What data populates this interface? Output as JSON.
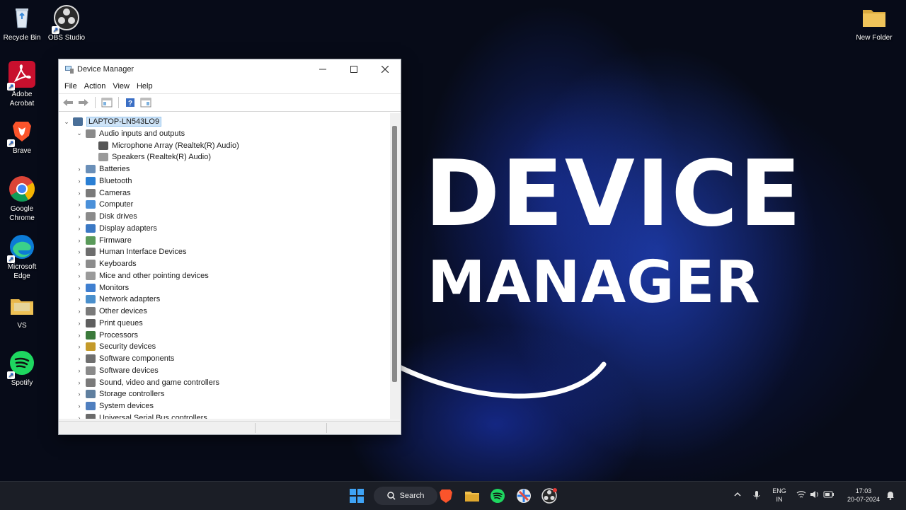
{
  "desktop": {
    "icons_left": [
      {
        "label": "Recycle Bin",
        "icon": "recycle-bin-icon"
      },
      {
        "label": "OBS Studio",
        "icon": "obs-icon"
      },
      {
        "label": "Adobe Acrobat",
        "icon": "acrobat-icon"
      },
      {
        "label": "Brave",
        "icon": "brave-icon"
      },
      {
        "label": "Google Chrome",
        "icon": "chrome-icon"
      },
      {
        "label": "Microsoft Edge",
        "icon": "edge-icon"
      },
      {
        "label": "VS",
        "icon": "folder-icon"
      },
      {
        "label": "Spotify",
        "icon": "spotify-icon"
      }
    ],
    "icon_right": {
      "label": "New Folder",
      "icon": "folder-icon"
    }
  },
  "window": {
    "title": "Device Manager",
    "menu": [
      "File",
      "Action",
      "View",
      "Help"
    ],
    "tree": {
      "root": "LAPTOP-LN543LO9",
      "expanded_category": "Audio inputs and outputs",
      "expanded_children": [
        "Microphone Array (Realtek(R) Audio)",
        "Speakers (Realtek(R) Audio)"
      ],
      "categories": [
        "Batteries",
        "Bluetooth",
        "Cameras",
        "Computer",
        "Disk drives",
        "Display adapters",
        "Firmware",
        "Human Interface Devices",
        "Keyboards",
        "Mice and other pointing devices",
        "Monitors",
        "Network adapters",
        "Other devices",
        "Print queues",
        "Processors",
        "Security devices",
        "Software components",
        "Software devices",
        "Sound, video and game controllers",
        "Storage controllers",
        "System devices",
        "Universal Serial Bus controllers"
      ]
    }
  },
  "headline": {
    "line1": "DEVICE",
    "line2": "MANAGER"
  },
  "taskbar": {
    "search_label": "Search",
    "language": "ENG",
    "region": "IN",
    "time": "17:03",
    "date": "20-07-2024"
  },
  "colors": {
    "accent": "#1a73e8",
    "selection": "#cde3f7",
    "taskbar": "#1b1e26"
  }
}
